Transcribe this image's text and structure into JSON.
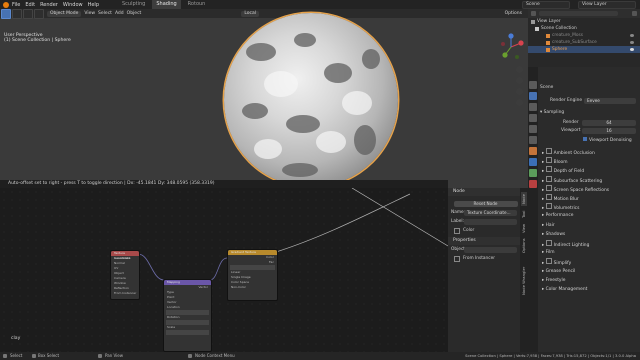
{
  "app": {
    "menu": [
      "File",
      "Edit",
      "Render",
      "Window",
      "Help"
    ],
    "workspace_tabs": [
      "Sculpting",
      "Shading",
      "Rotoun"
    ],
    "active_workspace": "Shading",
    "scene_label": "Scene",
    "view_layer_label": "View Layer"
  },
  "viewport": {
    "mode": "Object Mode",
    "menus": [
      "View",
      "Select",
      "Add",
      "Object"
    ],
    "transform_orientation": "Local",
    "options_label": "Options",
    "info_line1": "User Perspective",
    "info_line2": "(1) Scene Collection | Sphere",
    "status_message": "Auto-offset set to right - press T to toggle direction  |  Dx: -45.1841  Dy: 348.0595 (358.3319)"
  },
  "outliner": {
    "items": [
      {
        "label": "View Layer",
        "state": "normal"
      },
      {
        "label": "Scene Collection",
        "state": "normal"
      },
      {
        "label": "creature_Moss",
        "state": "dim"
      },
      {
        "label": "creature_SubSurface",
        "state": "dim"
      },
      {
        "label": "Sphere",
        "state": "selected"
      }
    ]
  },
  "properties": {
    "scene_label": "Scene",
    "render_engine_label": "Render Engine",
    "render_engine_value": "Eevee",
    "sampling_label": "Sampling",
    "render_label": "Render",
    "render_value": "64",
    "viewport_label": "Viewport",
    "viewport_value": "16",
    "denoise_label": "Viewport Denoising",
    "sections": [
      "Ambient Occlusion",
      "Bloom",
      "Depth of Field",
      "Subsurface Scattering",
      "Screen Space Reflections",
      "Motion Blur",
      "Volumetrics",
      "Performance",
      "Hair",
      "Shadows",
      "Indirect Lighting",
      "Film",
      "Simplify",
      "Grease Pencil",
      "Freestyle",
      "Color Management"
    ]
  },
  "node_panel": {
    "node_header": "Node",
    "reset_label": "Reset Node",
    "name_label": "Name:",
    "name_value": "Texture Coordinate...",
    "label_label": "Label:",
    "color_label": "Color",
    "properties_header": "Properties",
    "object_label": "Object",
    "from_instancer_label": "From Instancer",
    "tabs": [
      "Node",
      "Tool",
      "View",
      "Options",
      "Node Wrangler"
    ]
  },
  "node_editor": {
    "material_label": "clay",
    "nodes": [
      {
        "title": "Texture Coordinate",
        "rows": [
          "Generated",
          "Normal",
          "UV",
          "Object",
          "Camera",
          "Window",
          "Reflection",
          "Object",
          "From Instancer"
        ],
        "color": "#a84a4a"
      },
      {
        "title": "Mapping",
        "rows": [
          "Vector",
          "Type",
          "Point",
          "Vector",
          "Location",
          "Rotation",
          "Scale"
        ],
        "color": "#6a56a8"
      },
      {
        "title": "Gradient Texture",
        "rows": [
          "Color",
          "Fac",
          "Vector",
          "Repeat",
          "Linear",
          "Single Image",
          "Color Space",
          "Non-Color",
          "Vector"
        ],
        "color": "#b88a2c"
      }
    ]
  },
  "statusbar": {
    "left_items": [
      "Select",
      "Box Select",
      "Pan View",
      "Node Context Menu"
    ],
    "right_text": "Scene Collection | Sphere | Verts:7,938 | Faces:7,938 | Tris:15,872 | Objects:1/1 | 3.0.0 Alpha"
  },
  "colors": {
    "accent": "#4772b3",
    "selection_outline": "#e6a24a",
    "blender_logo": "#e87d0d"
  }
}
